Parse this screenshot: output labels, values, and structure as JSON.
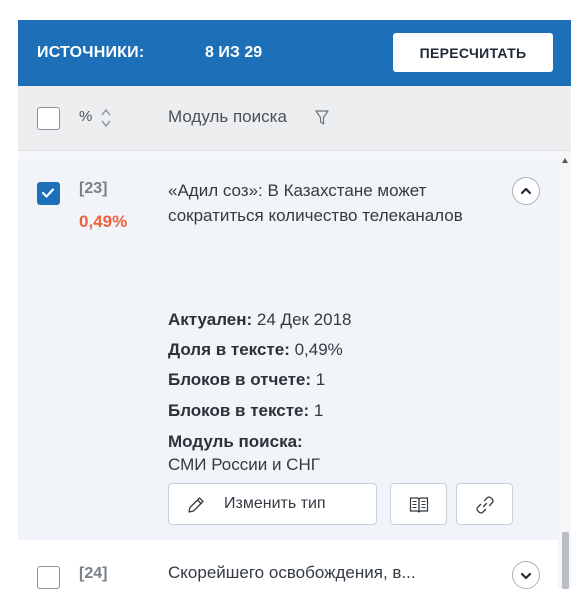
{
  "header": {
    "title": "ИСТОЧНИКИ:",
    "count": "8 ИЗ 29",
    "recalc_label": "ПЕРЕСЧИТАТЬ",
    "bg_color": "#1d6fb8"
  },
  "columns": {
    "percent_label": "%",
    "module_label": "Модуль поиска"
  },
  "sources": [
    {
      "number": "[23]",
      "percent": "0,49%",
      "checked": true,
      "expanded": true,
      "title": "«Адил соз»: В Казахстане может сократиться количество телеканалов",
      "details": {
        "actual_label": "Актуален:",
        "actual_value": "24 Дек 2018",
        "share_label": "Доля в тексте:",
        "share_value": "0,49%",
        "blocks_report_label": "Блоков в отчете:",
        "blocks_report_value": "1",
        "blocks_text_label": "Блоков в тексте:",
        "blocks_text_value": "1",
        "module_label": "Модуль поиска:",
        "module_value": "СМИ России и СНГ"
      },
      "edit_type_label": "Изменить тип"
    },
    {
      "number": "[24]",
      "checked": false,
      "expanded": false,
      "title": "Скорейшего освобождения, в..."
    }
  ],
  "icons": {
    "sort": "sort-arrows-icon",
    "filter": "filter-icon",
    "collapse": "chevron-up-icon",
    "expand": "chevron-down-icon",
    "edit": "pencil-icon",
    "book": "book-icon",
    "link": "link-icon",
    "check": "checkmark-icon"
  },
  "colors": {
    "accent": "#1d6fb8",
    "percent": "#f0603a"
  }
}
